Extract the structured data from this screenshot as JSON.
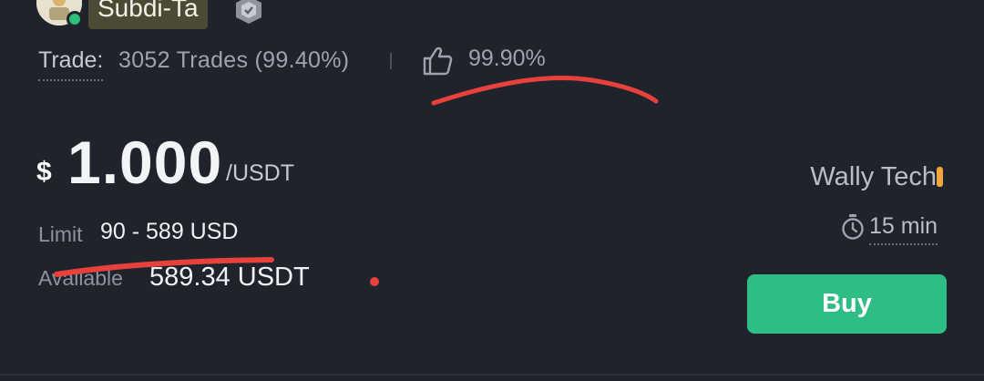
{
  "merchant": {
    "name": "Subdi-Ta",
    "online": true
  },
  "stats": {
    "trade_label": "Trade:",
    "trade_count": "3052 Trades",
    "completion_rate": "(99.40%)",
    "rating": "99.90%"
  },
  "price": {
    "symbol": "$",
    "value": "1.000",
    "unit": "/USDT"
  },
  "limit": {
    "label": "Limit",
    "value": "90 - 589 USD"
  },
  "available": {
    "label": "Available",
    "value": "589.34 USDT"
  },
  "payment": {
    "method": "Wally Tech",
    "accent_color": "#f0a63a"
  },
  "time_limit": "15 min",
  "buy_label": "Buy",
  "colors": {
    "background": "#1f232c",
    "buy_button": "#2ebd85",
    "annotation": "#e8403a"
  },
  "icons": {
    "verified": "verified-badge-icon",
    "rating": "thumbs-up-icon",
    "time": "stopwatch-icon"
  }
}
